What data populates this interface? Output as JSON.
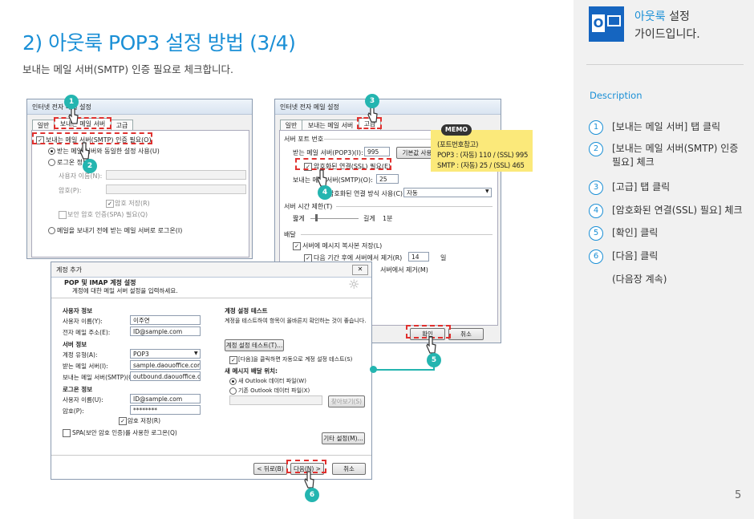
{
  "header": {
    "title": "2) 아웃룩 POP3 설정 방법 (3/4)",
    "subtitle": "보내는 메일 서버(SMTP) 인증 필요로 체크합니다."
  },
  "brand": {
    "logo_letter": "O",
    "name_highlight": "아웃룩",
    "name_rest": " 설정",
    "line2": "가이드입니다."
  },
  "description": {
    "heading": "Description",
    "steps": [
      {
        "num": "1",
        "text": "[보내는 메일 서버] 탭 클릭"
      },
      {
        "num": "2",
        "text": "[보내는 메일 서버(SMTP) 인증 필요] 체크"
      },
      {
        "num": "3",
        "text": "[고급] 탭 클릭"
      },
      {
        "num": "4",
        "text": "[암호화된 연결(SSL) 필요] 체크"
      },
      {
        "num": "5",
        "text": "[확인] 클릭"
      },
      {
        "num": "6",
        "text": "[다음] 클릭"
      }
    ],
    "note": "(다음장 계속)"
  },
  "page_number": "5",
  "dialog1": {
    "title": "인터넷 전자 메일 설정",
    "tabs": [
      "일반",
      "보내는 메일 서버",
      "고급"
    ],
    "smtp_auth": "보내는 메일 서버(SMTP) 인증 필요(O)",
    "same_as_incoming": "받는 메일 서버와 동일한 설정 사용(U)",
    "login_with": "로그온 정보",
    "username_label": "사용자 이름(N):",
    "password_label": "암호(P):",
    "remember": "암호 저장(R)",
    "spa": "보안 암호 인증(SPA) 필요(Q)",
    "logon_before": "메일을 보내기 전에 받는 메일 서버로 로그온(I)"
  },
  "dialog2": {
    "title": "인터넷 전자 메일 설정",
    "tabs": [
      "일반",
      "보내는 메일 서버",
      "고급"
    ],
    "port_section": "서버 포트 번호",
    "incoming_label": "받는 메일 서버(POP3)(I):",
    "incoming_port": "995",
    "default_btn": "기본값 사용",
    "ssl": "암호화된 연결(SSL) 필요(E)",
    "outgoing_label": "보내는 메일 서버(SMTP)(O):",
    "outgoing_port": "25",
    "enc_label": "암호화된 연결 방식 사용(C):",
    "enc_value": "자동",
    "timeout_section": "서버 시간 제한(T)",
    "short": "짧게",
    "long": "길게",
    "timeout_value": "1분",
    "delivery_section": "배달",
    "leave_copy": "서버에 메시지 복사본 저장(L)",
    "remove_after": "다음 기간 후에 서버에서 제거(R)",
    "days": "14",
    "days_unit": "일",
    "remove_deleted": "서버에서 제거(M)",
    "ok_btn": "확인",
    "cancel_btn": "취소"
  },
  "memo": {
    "tag": "MEMO",
    "lines": [
      "(포트번호참고)",
      "POP3 : (자동) 110 / (SSL) 995",
      "SMTP : (자동) 25 / (SSL) 465"
    ]
  },
  "dialog3": {
    "title": "계정 추가",
    "heading": "POP 및 IMAP 계정 설정",
    "subheading": "계정에 대한 메일 서버 설정을 입력하세요.",
    "user_section": "사용자 정보",
    "name_label": "사용자 이름(Y):",
    "name_value": "이주연",
    "email_label": "전자 메일 주소(E):",
    "email_value": "ID@sample.com",
    "server_section": "서버 정보",
    "type_label": "계정 유형(A):",
    "type_value": "POP3",
    "incoming_label": "받는 메일 서버(I):",
    "incoming_value": "sample.daouoffice.com",
    "outgoing_label": "보내는 메일 서버(SMTP)(O):",
    "outgoing_value": "outbound.daouoffice.com",
    "login_section": "로그온 정보",
    "user_label": "사용자 이름(U):",
    "user_value": "ID@sample.com",
    "pw_label": "암호(P):",
    "pw_value": "********",
    "remember": "암호 저장(R)",
    "spa": "SPA(보안 암호 인증)를 사용한 로그온(Q)",
    "test_section": "계정 설정 테스트",
    "test_desc": "계정을 테스트하여 항목이 올바른지 확인하는 것이 좋습니다.",
    "test_btn": "계정 설정 테스트(T)...",
    "auto_test": "[다음]을 클릭하면 자동으로 계정 설정 테스트(S)",
    "deliver_section": "새 메시지 배달 위치:",
    "new_pst": "새 Outlook 데이터 파일(W)",
    "existing_pst": "기존 Outlook 데이터 파일(X)",
    "browse_btn": "찾아보기(S)",
    "more_btn": "기타 설정(M)...",
    "back_btn": "< 뒤로(B)",
    "next_btn": "다음(N) >",
    "cancel_btn": "취소"
  },
  "markers": [
    "1",
    "2",
    "3",
    "4",
    "5",
    "6"
  ],
  "colors": {
    "accent": "#1a8fd6",
    "marker": "#24b5b0",
    "highlight": "#e0312f",
    "memo": "#fbe97a"
  }
}
